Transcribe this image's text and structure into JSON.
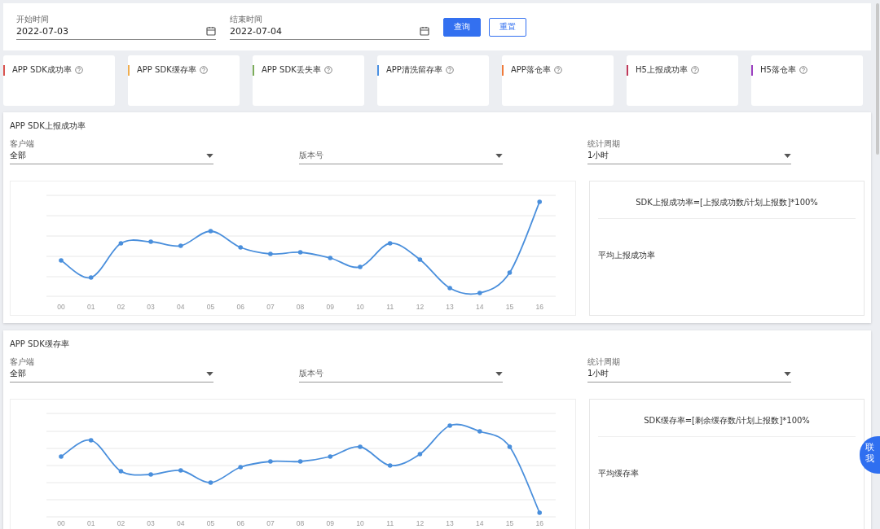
{
  "filters": {
    "fields": [
      {
        "label": "开始时间",
        "value": "2022-07-03"
      },
      {
        "label": "结束时间",
        "value": "2022-07-04"
      }
    ],
    "buttons": [
      {
        "label": "查询",
        "kind": "primary"
      },
      {
        "label": "重置",
        "kind": "outline"
      }
    ]
  },
  "metric_cards": [
    {
      "title": "APP SDK成功率",
      "color": "#d9534f"
    },
    {
      "title": "APP SDK缓存率",
      "color": "#f0ad4e"
    },
    {
      "title": "APP SDK丢失率",
      "color": "#7cac5a"
    },
    {
      "title": "APP清洗留存率",
      "color": "#4a90e2"
    },
    {
      "title": "APP落仓率",
      "color": "#f07a3a"
    },
    {
      "title": "H5上报成功率",
      "color": "#c0395a"
    },
    {
      "title": "H5落仓率",
      "color": "#9b3fc0"
    }
  ],
  "sections": [
    {
      "title": "APP SDK上报成功率",
      "selects": [
        {
          "label": "客户端",
          "value": "全部"
        },
        {
          "placeholder": "版本号"
        },
        {
          "label": "统计周期",
          "value": "1小时"
        }
      ],
      "x_labels": [
        "00",
        "01",
        "02",
        "03",
        "04",
        "05",
        "06",
        "07",
        "08",
        "09",
        "10",
        "11",
        "12",
        "13",
        "14",
        "15",
        "16"
      ],
      "formula": "SDK上报成功率=[上报成功数/计划上报数]*100%",
      "average_label": "平均上报成功率"
    },
    {
      "title": "APP SDK缓存率",
      "selects": [
        {
          "label": "客户端",
          "value": "全部"
        },
        {
          "placeholder": "版本号"
        },
        {
          "label": "统计周期",
          "value": "1小时"
        }
      ],
      "x_labels": [
        "00",
        "01",
        "02",
        "03",
        "04",
        "05",
        "06",
        "07",
        "08",
        "09",
        "10",
        "11",
        "12",
        "13",
        "14",
        "15",
        "16"
      ],
      "formula": "SDK缓存率=[剩余缓存数/计划上报数]*100%",
      "average_label": "平均缓存率"
    }
  ],
  "contact_button": "联我"
}
